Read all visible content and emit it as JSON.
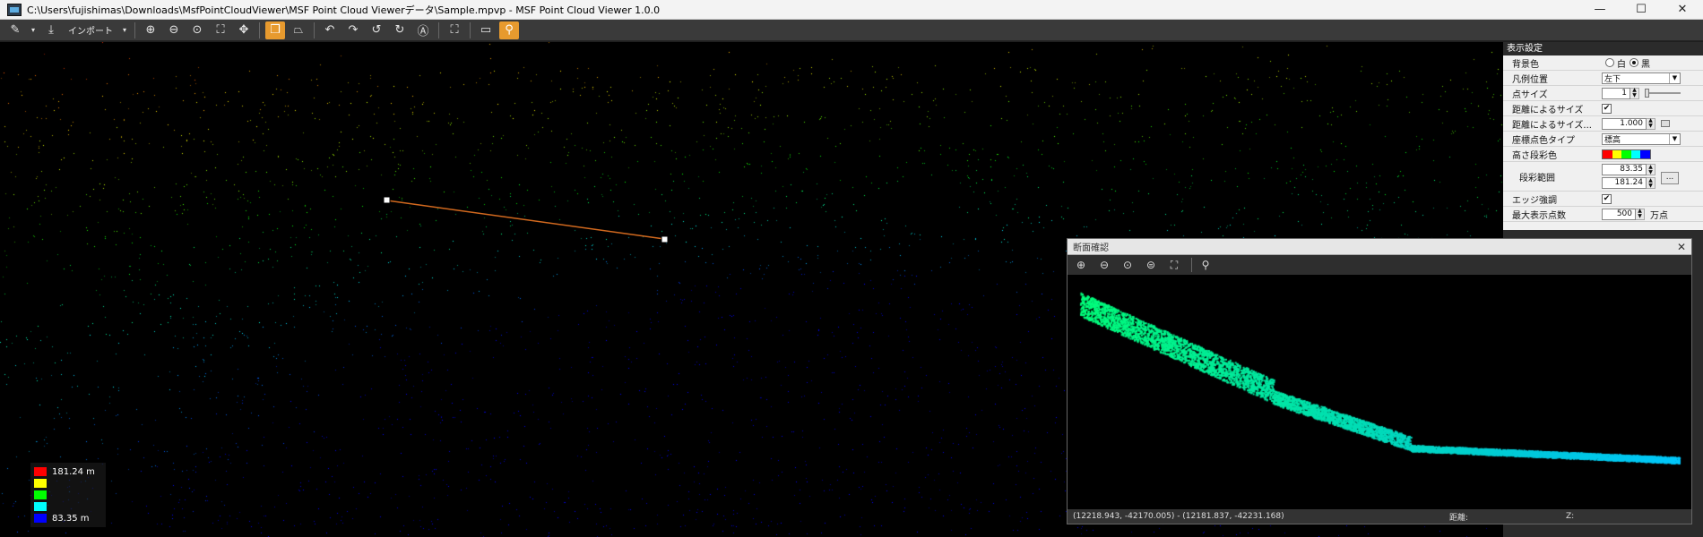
{
  "window": {
    "title": "C:\\Users\\fujishimas\\Downloads\\MsfPointCloudViewer\\MSF Point Cloud Viewerデータ\\Sample.mpvp - MSF Point Cloud Viewer 1.0.0",
    "minimize_glyph": "—",
    "maximize_glyph": "☐",
    "close_glyph": "✕"
  },
  "toolbar": {
    "import_label": "インポート",
    "icons": [
      "edit-icon",
      "dropdown-icon",
      "import-icon",
      "dropdown-icon",
      "zoom-in-icon",
      "zoom-out-icon",
      "zoom-area-icon",
      "fit-icon",
      "pan-icon",
      "box-view-icon",
      "slice-icon",
      "undo-icon",
      "redo-icon",
      "rotate-left-icon",
      "rotate-right-icon",
      "measure-icon",
      "fullscreen-icon",
      "ruler-icon",
      "section-tool-icon"
    ]
  },
  "legend": {
    "items": [
      {
        "color": "#ff0000",
        "label": "181.24 m"
      },
      {
        "color": "#ffff00",
        "label": ""
      },
      {
        "color": "#00ff00",
        "label": ""
      },
      {
        "color": "#00ffff",
        "label": ""
      },
      {
        "color": "#0000ff",
        "label": "83.35 m"
      }
    ]
  },
  "settings": {
    "header": "表示設定",
    "bg_color_label": "背景色",
    "bg_white": "白",
    "bg_black": "黒",
    "bg_selected": "黒",
    "legend_pos_label": "凡例位置",
    "legend_pos_value": "左下",
    "point_size_label": "点サイズ",
    "point_size_value": "1",
    "size_by_dist_label": "距離によるサイズ",
    "size_by_dist_checked": true,
    "size_by_dist2_label": "距離によるサイズ...",
    "size_by_dist2_value": "1.000",
    "color_type_label": "座標点色タイプ",
    "color_type_value": "標高",
    "elev_color_label": "高さ段彩色",
    "range_label": "段彩範囲",
    "range_min": "83.35",
    "range_max": "181.24",
    "range_btn": "...",
    "edge_label": "エッジ強調",
    "edge_checked": true,
    "max_points_label": "最大表示点数",
    "max_points_value": "500",
    "max_points_unit": "万点",
    "gradient_colors": [
      "#ff0000",
      "#ffff00",
      "#00ff00",
      "#00ffff",
      "#0000ff"
    ]
  },
  "section": {
    "title": "断面確認",
    "close_glyph": "✕",
    "status_coords": "(12218.943, -42170.005) - (12181.837, -42231.168)",
    "status_dist_label": "距離:",
    "status_z_label": "Z:"
  }
}
